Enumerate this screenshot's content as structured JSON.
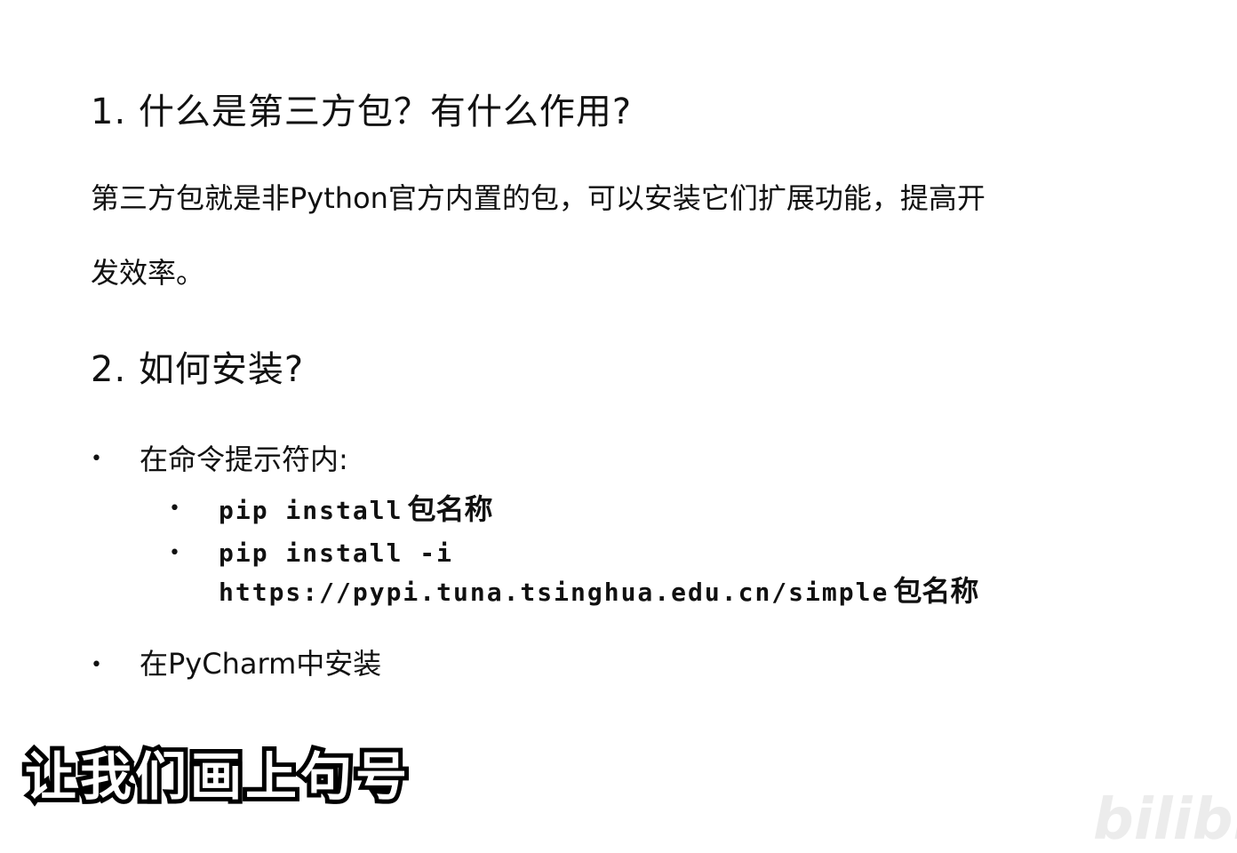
{
  "slide": {
    "heading1": "1. 什么是第三方包？有什么作用?",
    "para1": "第三方包就是非Python官方内置的包，可以安装它们扩展功能，提高开",
    "para2": "发效率。",
    "heading2": "2. 如何安装?",
    "bullets": [
      {
        "marker": "•",
        "text": "在命令提示符内:",
        "sub": [
          {
            "marker": "•",
            "code": "pip install",
            "suffix": "包名称"
          },
          {
            "marker": "•",
            "code": "pip install -i",
            "line2_code": "https://pypi.tuna.tsinghua.edu.cn/simple",
            "suffix": "包名称"
          }
        ]
      },
      {
        "marker": "•",
        "text": "在PyCharm中安装"
      }
    ]
  },
  "subtitle": "让我们画上句号",
  "watermark": "bilibili"
}
